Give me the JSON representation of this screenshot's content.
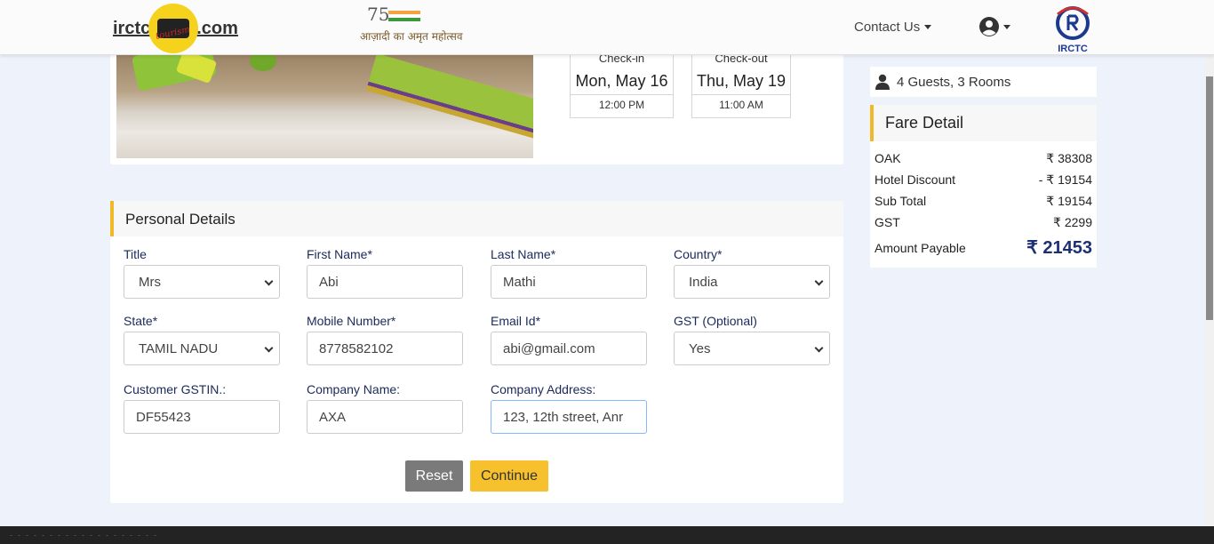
{
  "header": {
    "logo_left": "irctc",
    "logo_right": ".com",
    "logo_tagline": "tourism",
    "azadi_number": "75",
    "azadi_text": "आज़ादी का अमृत महोत्सव",
    "contact_label": "Contact Us",
    "irctc_label": "IRCTC"
  },
  "stay": {
    "checkin_label": "Check-in",
    "checkin_date": "Mon, May 16",
    "checkin_time": "12:00 PM",
    "checkout_label": "Check-out",
    "checkout_date": "Thu, May 19",
    "checkout_time": "11:00 AM"
  },
  "personal": {
    "heading": "Personal Details",
    "title_label": "Title",
    "title_value": "Mrs",
    "first_name_label": "First Name*",
    "first_name_value": "Abi",
    "last_name_label": "Last Name*",
    "last_name_value": "Mathi",
    "country_label": "Country*",
    "country_value": "India",
    "state_label": "State*",
    "state_value": "TAMIL NADU",
    "mobile_label": "Mobile Number*",
    "mobile_value": "8778582102",
    "email_label": "Email Id*",
    "email_value": "abi@gmail.com",
    "gst_label": "GST (Optional)",
    "gst_value": "Yes",
    "gstin_label": "Customer GSTIN.:",
    "gstin_value": "DF55423",
    "company_label": "Company Name:",
    "company_value": "AXA",
    "address_label": "Company Address:",
    "address_value": "123, 12th street, Anr",
    "reset_label": "Reset",
    "continue_label": "Continue"
  },
  "summary": {
    "guests_text": "4 Guests, 3 Rooms",
    "fare_heading": "Fare Detail",
    "rows": [
      {
        "label": "OAK",
        "amount": "₹ 38308"
      },
      {
        "label": "Hotel Discount",
        "amount": "- ₹ 19154"
      },
      {
        "label": "Sub Total",
        "amount": "₹ 19154"
      },
      {
        "label": "GST",
        "amount": "₹ 2299"
      }
    ],
    "total_label": "Amount Payable",
    "total_amount": "₹ 21453"
  },
  "colors": {
    "accent": "#f0b92a",
    "primary_dark": "#1c2f74",
    "button_continue": "#f7c12d",
    "button_reset": "#7a7a7a"
  },
  "icons": {
    "user_menu": "user-circle-icon",
    "guests": "user-icon",
    "select": "chevron-down-icon"
  }
}
